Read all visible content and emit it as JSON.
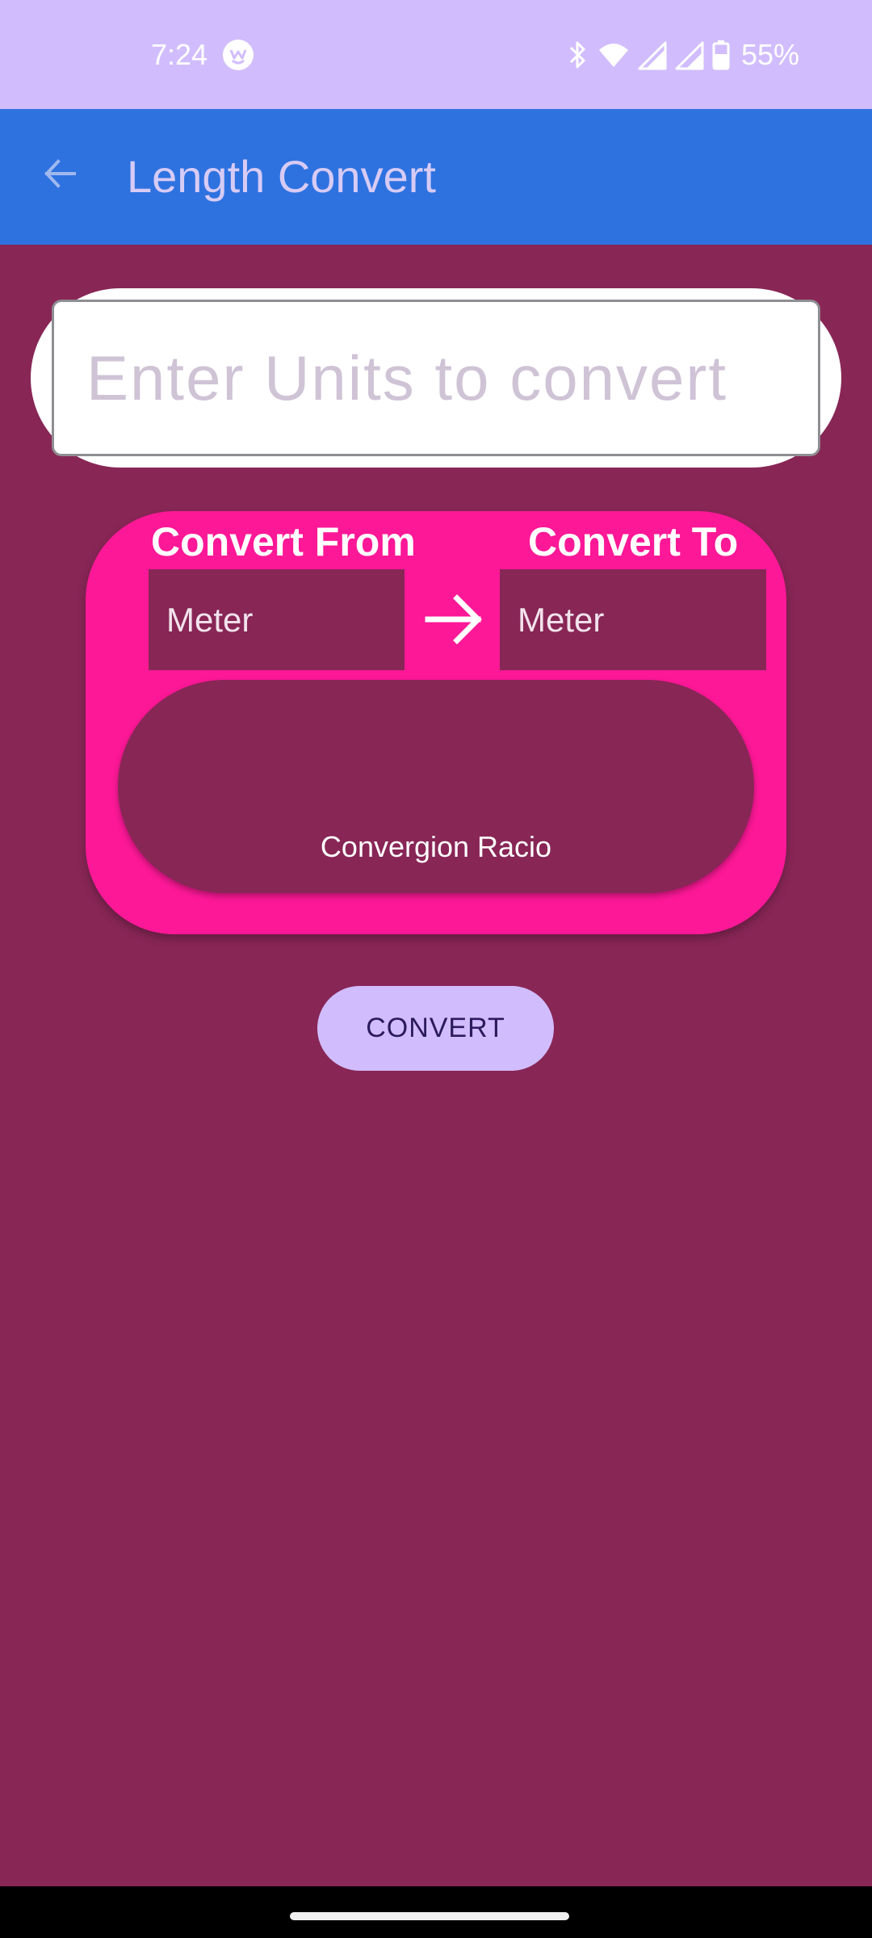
{
  "status_bar": {
    "time": "7:24",
    "battery_percent": "55%"
  },
  "app_bar": {
    "title": "Length Convert"
  },
  "input": {
    "placeholder": "Enter Units to convert",
    "value": ""
  },
  "converter": {
    "from_label": "Convert From",
    "to_label": "Convert To",
    "from_unit": "Meter",
    "to_unit": "Meter",
    "ratio_label": "Convergion Racio"
  },
  "actions": {
    "convert_label": "CONVERT"
  },
  "colors": {
    "background": "#882656",
    "status_bar": "#d1bdfd",
    "app_bar": "#2e72e0",
    "card": "#fd1897",
    "button": "#d1bdfd"
  },
  "icons": {
    "back": "arrow-left-icon",
    "convert_direction": "arrow-right-icon"
  }
}
